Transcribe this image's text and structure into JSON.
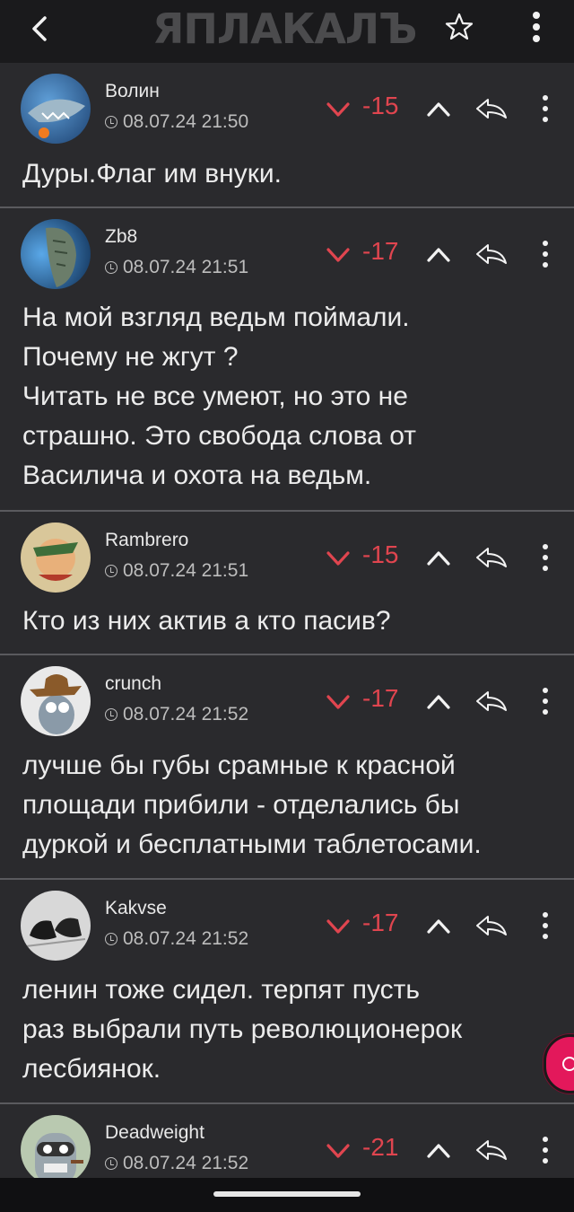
{
  "header": {
    "logo_text": "ЯПЛАКАЛЪ",
    "back_icon": "chevron-left-icon",
    "star_icon": "star-icon",
    "menu_icon": "kebab-menu-icon"
  },
  "comments": [
    {
      "author": "Волин",
      "time": "08.07.24 21:50",
      "score": "-15",
      "text": "Дуры.Флаг им внуки."
    },
    {
      "author": "Zb8",
      "time": "08.07.24 21:51",
      "score": "-17",
      "text": "На мой взгляд ведьм поймали.\nПочему не жгут ?\nЧитать не все умеют, но это не\nстрашно. Это свобода слова от\nВасилича и охота на ведьм."
    },
    {
      "author": "Rambrero",
      "time": "08.07.24 21:51",
      "score": "-15",
      "text": "Кто из них актив а кто пасив?"
    },
    {
      "author": "crunch",
      "time": "08.07.24 21:52",
      "score": "-17",
      "text": "лучше бы губы срамные к красной\nплощади прибили - отделались бы\nдуркой и бесплатными таблетосами."
    },
    {
      "author": "Kakvse",
      "time": "08.07.24 21:52",
      "score": "-17",
      "text": "ленин тоже сидел. терпят пусть\nраз выбрали путь революционерок\nлесбиянок."
    },
    {
      "author": "Deadweight",
      "time": "08.07.24 21:52",
      "score": "-21",
      "text": ""
    }
  ],
  "colors": {
    "background": "#111113",
    "card": "#2a2a2d",
    "negative_score": "#e0454f",
    "fab": "#e3185b"
  }
}
